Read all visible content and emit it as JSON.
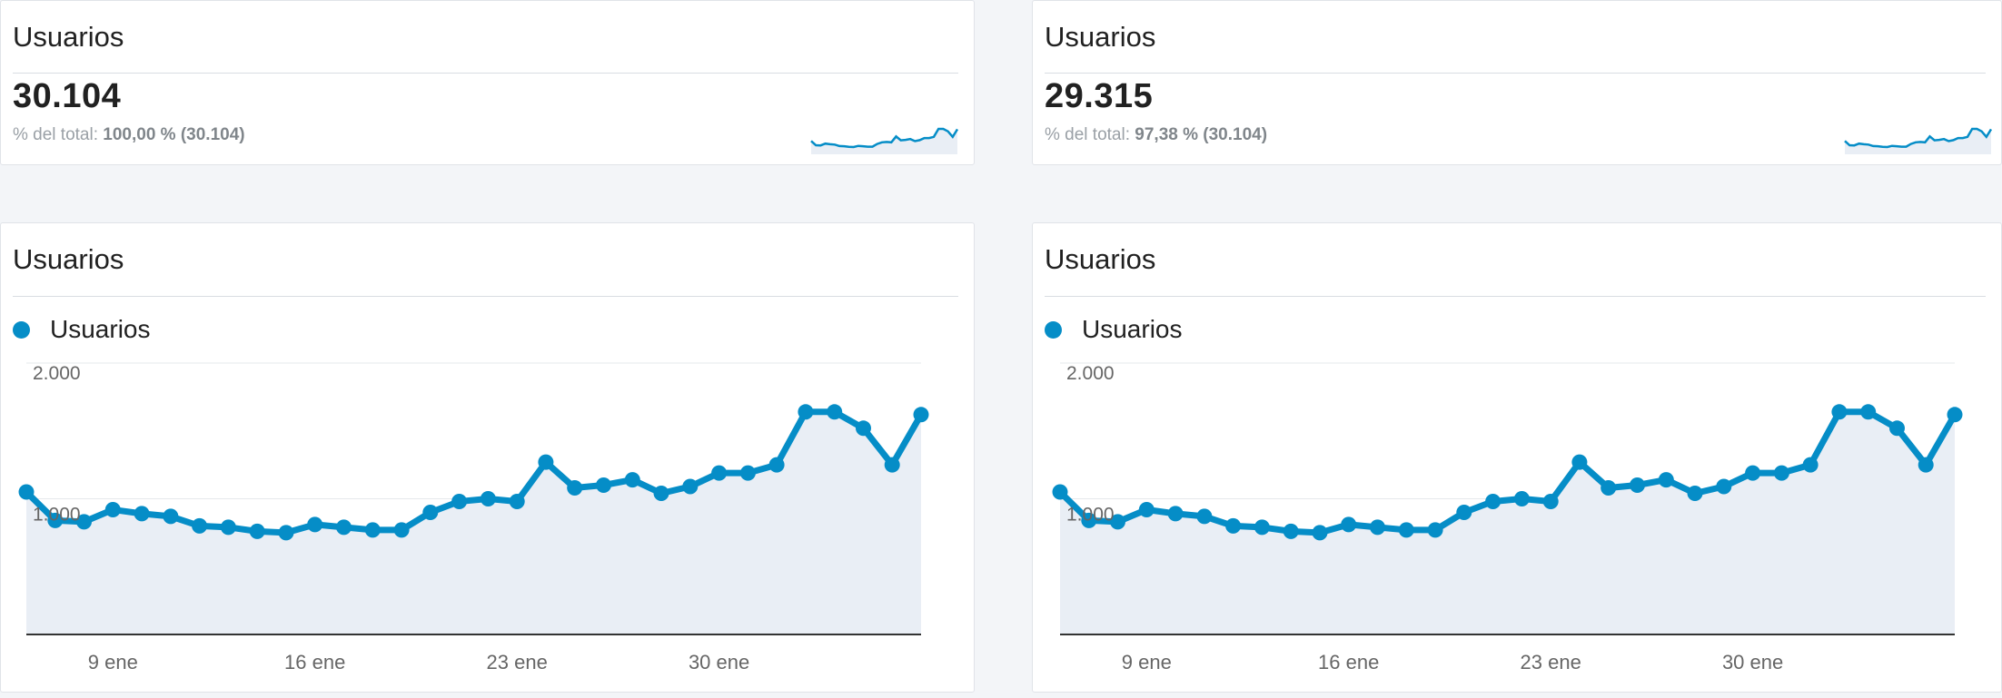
{
  "summary_cards": [
    {
      "title": "Usuarios",
      "value": "30.104",
      "pct_prefix": "% del total: ",
      "pct_value": "100,00 % (30.104)"
    },
    {
      "title": "Usuarios",
      "value": "29.315",
      "pct_prefix": "% del total: ",
      "pct_value": "97,38 % (30.104)"
    }
  ],
  "chart_cards": [
    {
      "title": "Usuarios",
      "legend": "Usuarios"
    },
    {
      "title": "Usuarios",
      "legend": "Usuarios"
    }
  ],
  "colors": {
    "series": "#058dc7",
    "area_fill": "#e9eef5",
    "grid": "#e6e8eb",
    "axis_text": "#666666"
  },
  "chart_data": [
    {
      "type": "area",
      "title": "Usuarios",
      "series": [
        {
          "name": "Usuarios",
          "values": [
            1050,
            840,
            830,
            920,
            890,
            870,
            800,
            790,
            760,
            750,
            810,
            790,
            770,
            770,
            900,
            980,
            1000,
            980,
            1270,
            1080,
            1100,
            1140,
            1040,
            1090,
            1190,
            1190,
            1250,
            1640,
            1640,
            1520,
            1250,
            1620
          ]
        }
      ],
      "x_tick_labels": [
        "9 ene",
        "16 ene",
        "23 ene",
        "30 ene"
      ],
      "x_tick_index": [
        3,
        10,
        17,
        24
      ],
      "y_tick_labels": [
        "1.000",
        "2.000"
      ],
      "y_tick_values": [
        1000,
        2000
      ],
      "ylim": [
        0,
        2000
      ],
      "grid": true,
      "legend_position": "top-left"
    },
    {
      "type": "area",
      "title": "Usuarios",
      "series": [
        {
          "name": "Usuarios",
          "values": [
            1050,
            840,
            830,
            920,
            890,
            870,
            800,
            790,
            760,
            750,
            810,
            790,
            770,
            770,
            900,
            980,
            1000,
            980,
            1270,
            1080,
            1100,
            1140,
            1040,
            1090,
            1190,
            1190,
            1250,
            1640,
            1640,
            1520,
            1250,
            1620
          ]
        }
      ],
      "x_tick_labels": [
        "9 ene",
        "16 ene",
        "23 ene",
        "30 ene"
      ],
      "x_tick_index": [
        3,
        10,
        17,
        24
      ],
      "y_tick_labels": [
        "1.000",
        "2.000"
      ],
      "y_tick_values": [
        1000,
        2000
      ],
      "ylim": [
        0,
        2000
      ],
      "grid": true,
      "legend_position": "top-left"
    }
  ]
}
